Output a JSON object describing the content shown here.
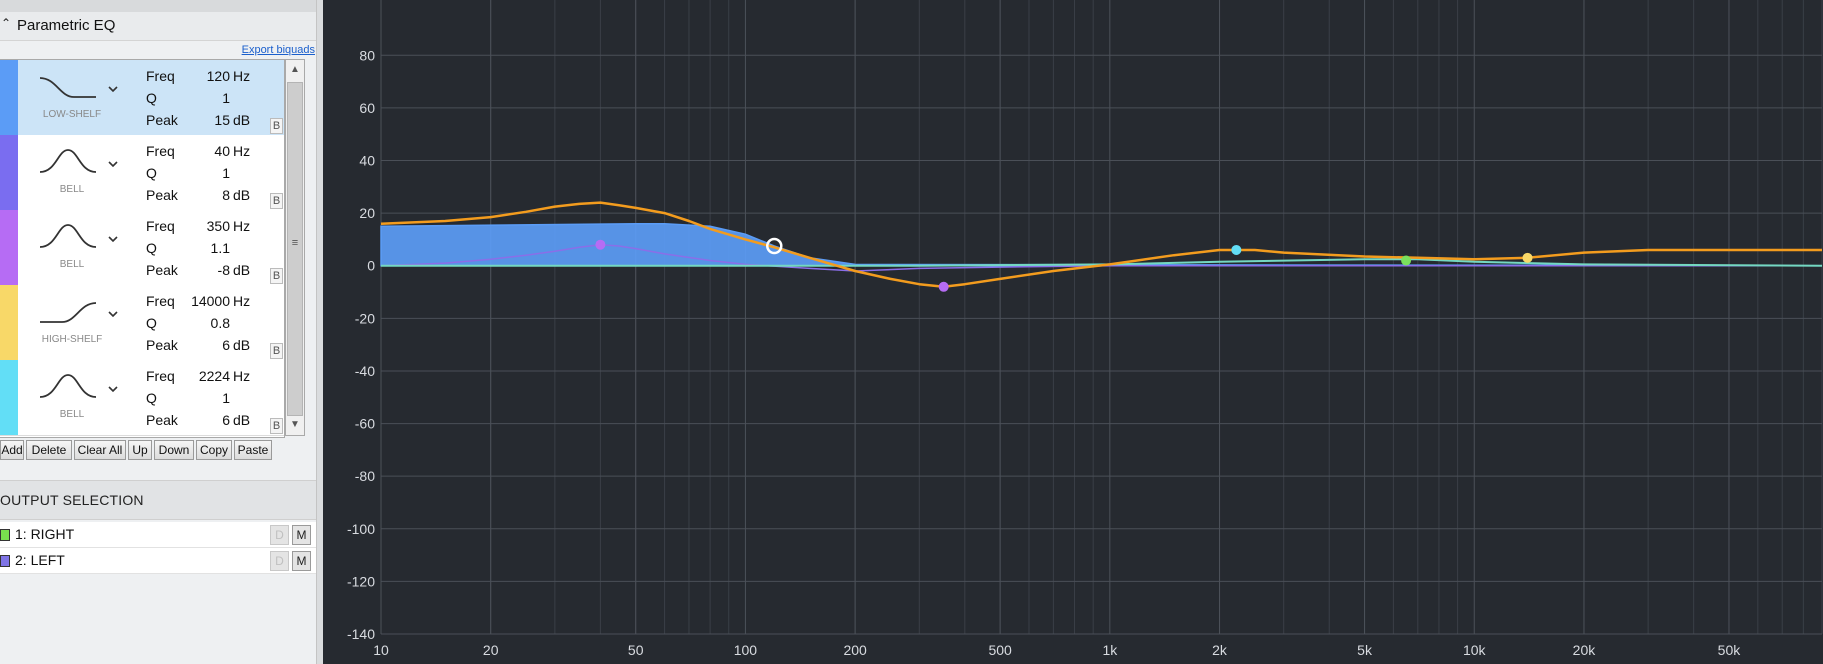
{
  "eq_panel": {
    "title": "Parametric EQ",
    "collapse_icon": "chevron-up-icon",
    "export_label": "Export biquads"
  },
  "labels": {
    "freq": "Freq",
    "q": "Q",
    "peak": "Peak",
    "hz": "Hz",
    "db": "dB",
    "bypass": "B"
  },
  "filters": [
    {
      "type": "LOW-SHELF",
      "icon": "low-shelf-curve-icon",
      "color": "#5b9cf6",
      "freq": "120",
      "q": "1",
      "peak": "15",
      "selected": true
    },
    {
      "type": "BELL",
      "icon": "bell-curve-icon",
      "color": "#7a6df0",
      "freq": "40",
      "q": "1",
      "peak": "8",
      "selected": false
    },
    {
      "type": "BELL",
      "icon": "bell-curve-icon",
      "color": "#b66cf4",
      "freq": "350",
      "q": "1.1",
      "peak": "-8",
      "selected": false
    },
    {
      "type": "HIGH-SHELF",
      "icon": "high-shelf-curve-icon",
      "color": "#f8d868",
      "freq": "14000",
      "q": "0.8",
      "peak": "6",
      "selected": false
    },
    {
      "type": "BELL",
      "icon": "bell-curve-icon",
      "color": "#62def6",
      "freq": "2224",
      "q": "1",
      "peak": "6",
      "selected": false
    }
  ],
  "toolbar": {
    "add": "Add",
    "delete": "Delete",
    "clear_all": "Clear All",
    "up": "Up",
    "down": "Down",
    "copy": "Copy",
    "paste": "Paste"
  },
  "output": {
    "title": "OUTPUT SELECTION",
    "channels": [
      {
        "label": "1: RIGHT",
        "color": "#79e04e",
        "d": "D",
        "m": "M"
      },
      {
        "label": "2: LEFT",
        "color": "#7f74e6",
        "d": "D",
        "m": "M"
      }
    ]
  },
  "chart_data": {
    "type": "line",
    "xscale": "log",
    "xlim": [
      10,
      90000
    ],
    "ylim": [
      -140,
      90
    ],
    "xticks": [
      {
        "v": 10,
        "label": "10"
      },
      {
        "v": 20,
        "label": "20"
      },
      {
        "v": 50,
        "label": "50"
      },
      {
        "v": 100,
        "label": "100"
      },
      {
        "v": 200,
        "label": "200"
      },
      {
        "v": 500,
        "label": "500"
      },
      {
        "v": 1000,
        "label": "1k"
      },
      {
        "v": 2000,
        "label": "2k"
      },
      {
        "v": 5000,
        "label": "5k"
      },
      {
        "v": 10000,
        "label": "10k"
      },
      {
        "v": 20000,
        "label": "20k"
      },
      {
        "v": 50000,
        "label": "50k"
      }
    ],
    "yticks": [
      80,
      60,
      40,
      20,
      0,
      -20,
      -40,
      -60,
      -80,
      -100,
      -120,
      -140
    ],
    "grid": true,
    "colors": {
      "combined": "#f39c1e",
      "selected_fill": "#5b9cf6",
      "left_channel": "#8a6ee8",
      "right_channel": "#74d8c2"
    },
    "series": [
      {
        "x": [
          10,
          15,
          20,
          25,
          30,
          35,
          40,
          45,
          50,
          60,
          70,
          80,
          100,
          120,
          150,
          200,
          250,
          300,
          350,
          400,
          500,
          700,
          1000,
          1500,
          2000,
          2500,
          3000,
          5000,
          7000,
          10000,
          14000,
          20000,
          30000,
          50000,
          90000
        ],
        "y": [
          16,
          17,
          18.5,
          20.5,
          22.5,
          23.5,
          24,
          23,
          22,
          20,
          17,
          14,
          10,
          7,
          3,
          -2,
          -5,
          -7,
          -8,
          -7,
          -5,
          -2,
          0.5,
          4,
          6,
          6,
          5,
          3.5,
          3,
          2.5,
          3,
          5,
          6,
          6,
          6
        ]
      },
      {
        "x": [
          10,
          50,
          60,
          80,
          100,
          120,
          150,
          200,
          90000
        ],
        "y": [
          15,
          16,
          16,
          15,
          12,
          7.5,
          3,
          0.5,
          0
        ]
      },
      {
        "x": [
          10,
          15,
          20,
          25,
          30,
          35,
          40,
          45,
          50,
          60,
          80,
          100,
          150,
          200,
          300,
          500,
          1000,
          90000
        ],
        "y": [
          0,
          1,
          2.5,
          4,
          5.5,
          7,
          8,
          7.5,
          6.5,
          4.5,
          2,
          0.5,
          -1,
          -2,
          -1,
          -0.5,
          0,
          0
        ]
      },
      {
        "x": [
          10,
          300,
          1000,
          2000,
          5000,
          7000,
          10000,
          20000,
          90000
        ],
        "y": [
          0,
          0,
          0.5,
          1.5,
          2.5,
          2.5,
          1.5,
          0.5,
          0
        ]
      }
    ],
    "points": [
      {
        "f": 120,
        "g": 7.5,
        "color": "#ffffff",
        "selected": true
      },
      {
        "f": 40,
        "g": 8,
        "color": "#b66cf4"
      },
      {
        "f": 350,
        "g": -8,
        "color": "#b66cf4"
      },
      {
        "f": 2224,
        "g": 6,
        "color": "#62def6"
      },
      {
        "f": 6500,
        "g": 2,
        "color": "#7ae05c"
      },
      {
        "f": 14000,
        "g": 3,
        "color": "#f8d868"
      }
    ]
  }
}
